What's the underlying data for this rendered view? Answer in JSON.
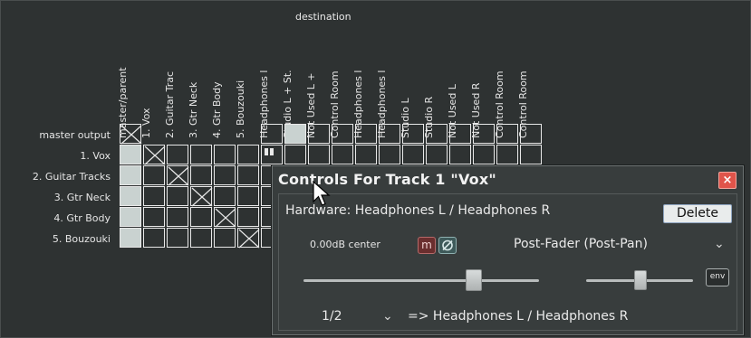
{
  "matrix": {
    "title": "destination",
    "columns": [
      "master/parent",
      "1. Vox",
      "2. Guitar Trac",
      "3. Gtr Neck",
      "4. Gtr Body",
      "5. Bouzouki",
      "Headphones l",
      "Studio L + St.",
      "Not Used L +",
      "Control Room",
      "Headphones l",
      "Headphones l",
      "Studio L",
      "Studio R",
      "Not Used L",
      "Not Used R",
      "Control Room",
      "Control Room"
    ],
    "rows": [
      "master output",
      "1. Vox",
      "2. Guitar Tracks",
      "3. Gtr Neck",
      "4. Gtr Body",
      "5. Bouzouki"
    ]
  },
  "dialog": {
    "title": "Controls For Track 1 \"Vox\"",
    "close_label": "×",
    "hardware_label": "Hardware: Headphones L / Headphones R",
    "delete_label": "Delete",
    "volume_pan_label": "0.00dB center",
    "mute_label": "m",
    "send_mode": "Post-Fader (Post-Pan)",
    "env_label": "env",
    "channel_select": "1/2",
    "destination_label": "=> Headphones L / Headphones R",
    "volume_level": 0.72,
    "pan_level": 0.5
  },
  "colors": {
    "background": "#2e3232",
    "cell_fill": "#c9d2d0",
    "close_red": "#e0544a"
  }
}
